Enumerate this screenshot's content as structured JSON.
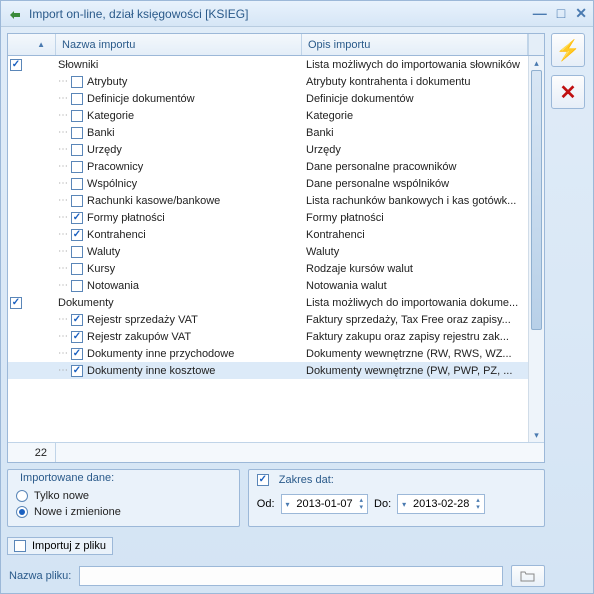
{
  "window": {
    "title": "Import on-line, dział księgowości [KSIEG]"
  },
  "grid": {
    "header_name": "Nazwa importu",
    "header_desc": "Opis importu",
    "count": "22",
    "rows": [
      {
        "level": 0,
        "checked": true,
        "name": "Słowniki",
        "desc": "Lista możliwych do importowania słowników"
      },
      {
        "level": 1,
        "checked": false,
        "name": "Atrybuty",
        "desc": "Atrybuty kontrahenta i dokumentu"
      },
      {
        "level": 1,
        "checked": false,
        "name": "Definicje dokumentów",
        "desc": "Definicje dokumentów"
      },
      {
        "level": 1,
        "checked": false,
        "name": "Kategorie",
        "desc": "Kategorie"
      },
      {
        "level": 1,
        "checked": false,
        "name": "Banki",
        "desc": "Banki"
      },
      {
        "level": 1,
        "checked": false,
        "name": "Urzędy",
        "desc": "Urzędy"
      },
      {
        "level": 1,
        "checked": false,
        "name": "Pracownicy",
        "desc": "Dane personalne pracowników"
      },
      {
        "level": 1,
        "checked": false,
        "name": "Wspólnicy",
        "desc": "Dane personalne wspólników"
      },
      {
        "level": 1,
        "checked": false,
        "name": "Rachunki kasowe/bankowe",
        "desc": "Lista rachunków bankowych i kas gotówk..."
      },
      {
        "level": 1,
        "checked": true,
        "name": "Formy płatności",
        "desc": "Formy płatności"
      },
      {
        "level": 1,
        "checked": true,
        "name": "Kontrahenci",
        "desc": "Kontrahenci"
      },
      {
        "level": 1,
        "checked": false,
        "name": "Waluty",
        "desc": "Waluty"
      },
      {
        "level": 1,
        "checked": false,
        "name": "Kursy",
        "desc": "Rodzaje kursów walut"
      },
      {
        "level": 1,
        "checked": false,
        "name": "Notowania",
        "desc": "Notowania walut"
      },
      {
        "level": 0,
        "checked": true,
        "name": "Dokumenty",
        "desc": "Lista możliwych do importowania dokume..."
      },
      {
        "level": 1,
        "checked": true,
        "name": "Rejestr sprzedaży VAT",
        "desc": "Faktury sprzedaży, Tax Free oraz zapisy..."
      },
      {
        "level": 1,
        "checked": true,
        "name": "Rejestr zakupów VAT",
        "desc": "Faktury zakupu oraz zapisy rejestru zak..."
      },
      {
        "level": 1,
        "checked": true,
        "name": "Dokumenty inne przychodowe",
        "desc": "Dokumenty wewnętrzne (RW, RWS, WZ..."
      },
      {
        "level": 1,
        "checked": true,
        "name": "Dokumenty inne kosztowe",
        "desc": "Dokumenty wewnętrzne (PW, PWP, PZ, ...",
        "sel": true
      }
    ]
  },
  "panel_left": {
    "title": "Importowane dane:",
    "opt_new": "Tylko nowe",
    "opt_changed": "Nowe i zmienione"
  },
  "panel_right": {
    "title": "Zakres dat:",
    "od_label": "Od:",
    "do_label": "Do:",
    "od_val": "2013-01-07",
    "do_val": "2013-02-28"
  },
  "file": {
    "import_label": "Importuj z pliku",
    "name_label": "Nazwa pliku:"
  }
}
